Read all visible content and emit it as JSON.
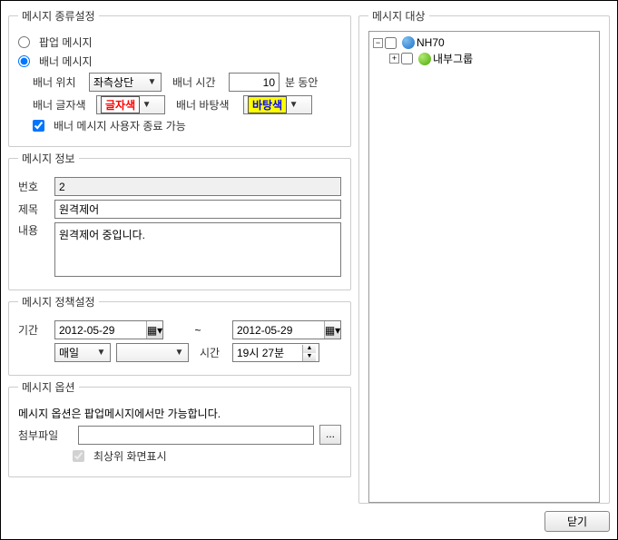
{
  "type_settings": {
    "legend": "메시지 종류설정",
    "popup_label": "팝업 메시지",
    "banner_label": "배너 메시지",
    "banner_position_label": "배너 위치",
    "banner_position_value": "좌측상단",
    "banner_time_label": "배너 시간",
    "banner_time_value": "10",
    "banner_time_suffix": "분 동안",
    "banner_text_color_label": "배너 글자색",
    "banner_text_color_swatch": "글자색",
    "banner_bg_color_label": "배너 바탕색",
    "banner_bg_color_swatch": "바탕색",
    "banner_user_close_label": "배너 메시지 사용자 종료 가능"
  },
  "info": {
    "legend": "메시지 정보",
    "number_label": "번호",
    "number_value": "2",
    "title_label": "제목",
    "title_value": "원격제어",
    "content_label": "내용",
    "content_value": "원격제어 중입니다."
  },
  "policy": {
    "legend": "메시지 정책설정",
    "period_label": "기간",
    "start_date": "2012-05-29",
    "tilde": "~",
    "end_date": "2012-05-29",
    "freq_value": "매일",
    "freq_opt_empty": "",
    "time_label": "시간",
    "time_value": "19시 27분"
  },
  "options": {
    "legend": "메시지 옵션",
    "note": "메시지 옵션은 팝업메시지에서만 가능합니다.",
    "attach_label": "첨부파일",
    "browse_label": "...",
    "topmost_label": "최상위 화면표시"
  },
  "target": {
    "legend": "메시지 대상",
    "node1": "NH70",
    "node2": "내부그룹"
  },
  "footer": {
    "close": "닫기"
  }
}
